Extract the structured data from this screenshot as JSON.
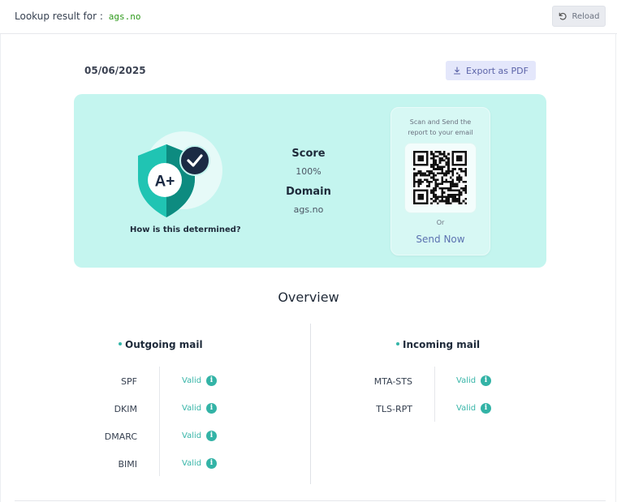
{
  "header": {
    "lookup_label": "Lookup result for :",
    "domain": "ags.no",
    "reload_label": "Reload"
  },
  "report": {
    "date": "05/06/2025",
    "export_label": "Export as PDF"
  },
  "grade_card": {
    "grade": "A+",
    "how_label": "How is this determined?",
    "score_label": "Score",
    "score_value": "100%",
    "domain_label": "Domain",
    "domain_value": "ags.no",
    "qr_line1": "Scan and Send the",
    "qr_line2": "report to your email",
    "or_label": "Or",
    "send_label": "Send Now"
  },
  "overview": {
    "title": "Overview",
    "outgoing": {
      "title": "Outgoing mail",
      "rows": [
        {
          "name": "SPF",
          "status": "Valid"
        },
        {
          "name": "DKIM",
          "status": "Valid"
        },
        {
          "name": "DMARC",
          "status": "Valid"
        },
        {
          "name": "BIMI",
          "status": "Valid"
        }
      ]
    },
    "incoming": {
      "title": "Incoming mail",
      "rows": [
        {
          "name": "MTA-STS",
          "status": "Valid"
        },
        {
          "name": "TLS-RPT",
          "status": "Valid"
        }
      ]
    }
  },
  "colors": {
    "card_bg": "#c4f5ef",
    "accent": "#33b3a6",
    "shield_dark": "#0d8b80",
    "badge_navy": "#1b2a44",
    "domain_green": "#2f9a1c"
  },
  "icons": [
    "reload-icon",
    "download-icon",
    "shield-grade-icon",
    "check-badge-icon",
    "qr-code",
    "info-icon"
  ]
}
